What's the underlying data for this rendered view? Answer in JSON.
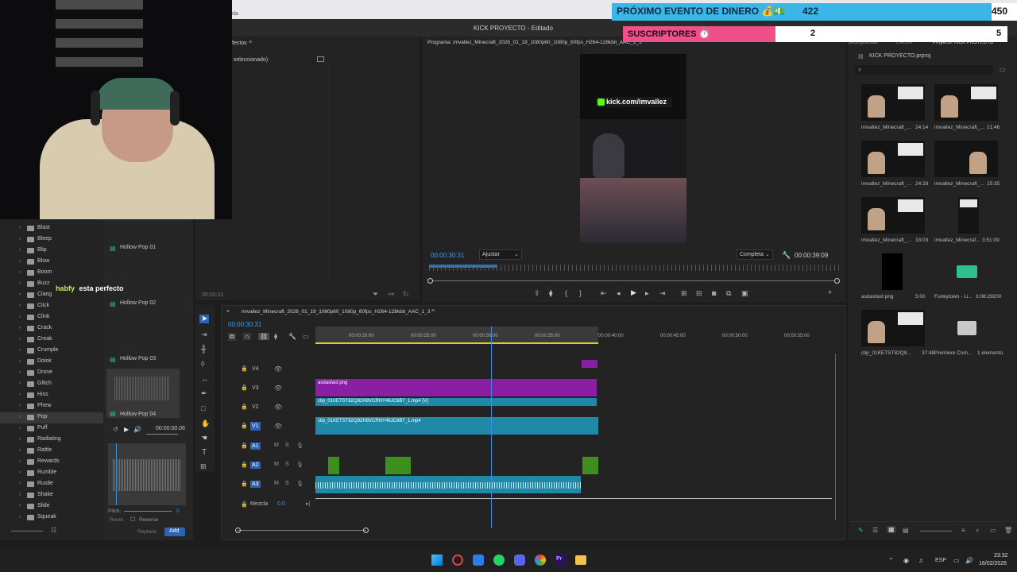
{
  "topstrip": {
    "text": "da"
  },
  "window": {
    "title": "KICK PROYECTO - Editado"
  },
  "overlay": {
    "event_label": "PRÓXIMO EVENTO DE DINERO 💰💵",
    "event_value": "422",
    "event_goal": "450",
    "subs_label": "SUSCRIPTORES ⏱️",
    "subs_value": "2",
    "subs_goal": "5"
  },
  "chat": {
    "user": "habfy",
    "message": "esta perfecto"
  },
  "effects_panel": {
    "title": "fectos",
    "selected": "ı seleccionado)",
    "time": "00:00:31"
  },
  "sfx_categories": [
    "Blast",
    "Bleep",
    "Blip",
    "Blow",
    "Boom",
    "Buzz",
    "Clang",
    "Click",
    "Clink",
    "Crack",
    "Creak",
    "Crumple",
    "Doink",
    "Drone",
    "Glitch",
    "Hiss",
    "Phew",
    "Pop",
    "Puff",
    "Radiating",
    "Rattle",
    "Rewards",
    "Rumble",
    "Rustle",
    "Shake",
    "Slide",
    "Squeak"
  ],
  "sfx_selected": "Pop",
  "sfx_items": [
    "Hollow Pop 01",
    "Hollow Pop 02",
    "Hollow Pop 03",
    "Hollow Pop 04"
  ],
  "sfx_preview": {
    "time": "00:00:00.06",
    "pitch_label": "Pitch:",
    "pitch_value": "0",
    "reset": "Reset",
    "reverse": "Reverse",
    "replace": "Replace",
    "add": "Add"
  },
  "program": {
    "title": "Programa: imvallez_Minecraft_2026_01_19_1080p60_1080p_60fps_H264-128kbit_AAC_1_3",
    "current_time": "00:00:30:31",
    "fit": "Ajustar",
    "quality": "Completa",
    "duration": "00:00:39:09",
    "watermark": "kick.com/imvallez"
  },
  "project": {
    "tabs": [
      "yectogitalstaa",
      "Efectos",
      "Proyecto: KICK PROYECTO"
    ],
    "file": "KICK PROYECTO.prproj",
    "items": [
      {
        "name": "imvallez_Minecraft_...",
        "dur": "24:14"
      },
      {
        "name": "imvallez_Minecraft_...",
        "dur": "21:46"
      },
      {
        "name": "imvallez_Minecraft_...",
        "dur": "24:28"
      },
      {
        "name": "imvallez_Minecraft_...",
        "dur": "15:35"
      },
      {
        "name": "imvallez_Minecraft_...",
        "dur": "33:03"
      },
      {
        "name": "imvallez_Minecraf...",
        "dur": "3:51:09"
      },
      {
        "name": "asdasfasf.png",
        "dur": "5:00"
      },
      {
        "name": "Funkytown - Li...",
        "dur": "3:08:29200"
      },
      {
        "name": "clip_01KETST82Q8...",
        "dur": "37:48"
      },
      {
        "name": "Premiere Com...",
        "dur": "1 elemento"
      }
    ]
  },
  "timeline": {
    "sequence": "imvallez_Minecraft_2026_01_19_1080p60_1080p_60fps_H264-128kbit_AAC_1_3",
    "timecode": "00:00:30:31",
    "ruler": [
      "00:00:20:00",
      "00:00:25:00",
      "00:00:30:00",
      "00:00:35:00",
      "00:00:40:00",
      "00:00:45:00",
      "00:00:50:00",
      "00:00:55:00"
    ],
    "video_tracks": [
      "V4",
      "V3",
      "V2",
      "V1"
    ],
    "audio_tracks": [
      "A1",
      "A2",
      "A3"
    ],
    "mix_label": "Mezcla",
    "mix_value": "0.0",
    "clips": {
      "v3": "asdasfasf.png",
      "v2": "clip_01KETST82Q82H8VCRNY46JC6B7_1.mp4 [V]",
      "v1": "clip_01KETST82Q82H8VCRNY46JC6B7_1.mp4"
    }
  },
  "taskbar": {
    "lang": "ESP",
    "time": "23:32",
    "date": "16/02/2026"
  }
}
